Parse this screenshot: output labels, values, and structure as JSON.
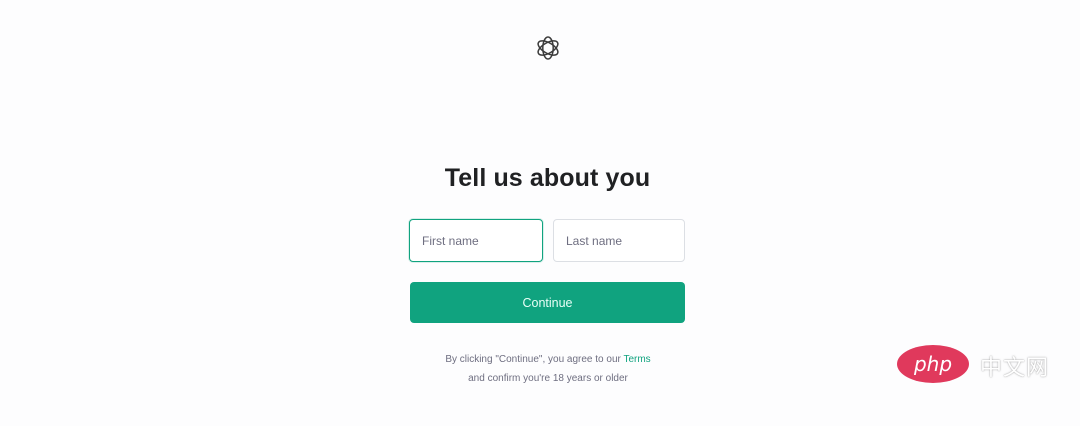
{
  "page": {
    "logo_icon": "openai-logo-icon",
    "title": "Tell us about you"
  },
  "form": {
    "first_name_placeholder": "First name",
    "first_name_value": "",
    "last_name_placeholder": "Last name",
    "last_name_value": "",
    "continue_label": "Continue"
  },
  "legal": {
    "line1_prefix": "By clicking \"Continue\", you agree to our ",
    "terms_link": "Terms",
    "line2": "and confirm you're 18 years or older"
  },
  "watermark": {
    "logo_text": "php",
    "cn_text": "中文网"
  },
  "colors": {
    "accent": "#10a37f",
    "title": "#202123",
    "muted": "#6e6e80",
    "watermark": "#e0395c"
  }
}
